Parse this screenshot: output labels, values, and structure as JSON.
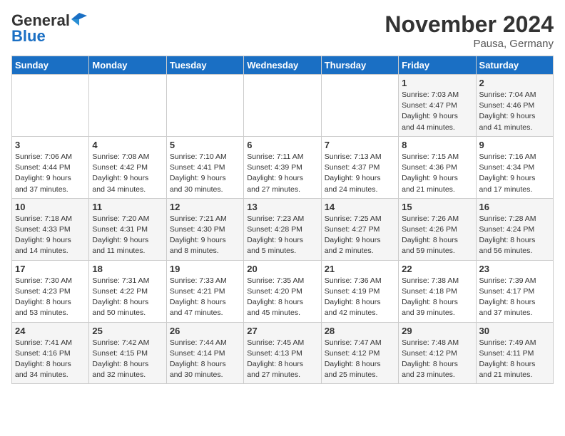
{
  "header": {
    "logo_line1": "General",
    "logo_line2": "Blue",
    "month": "November 2024",
    "location": "Pausa, Germany"
  },
  "weekdays": [
    "Sunday",
    "Monday",
    "Tuesday",
    "Wednesday",
    "Thursday",
    "Friday",
    "Saturday"
  ],
  "weeks": [
    [
      {
        "day": "",
        "info": ""
      },
      {
        "day": "",
        "info": ""
      },
      {
        "day": "",
        "info": ""
      },
      {
        "day": "",
        "info": ""
      },
      {
        "day": "",
        "info": ""
      },
      {
        "day": "1",
        "info": "Sunrise: 7:03 AM\nSunset: 4:47 PM\nDaylight: 9 hours\nand 44 minutes."
      },
      {
        "day": "2",
        "info": "Sunrise: 7:04 AM\nSunset: 4:46 PM\nDaylight: 9 hours\nand 41 minutes."
      }
    ],
    [
      {
        "day": "3",
        "info": "Sunrise: 7:06 AM\nSunset: 4:44 PM\nDaylight: 9 hours\nand 37 minutes."
      },
      {
        "day": "4",
        "info": "Sunrise: 7:08 AM\nSunset: 4:42 PM\nDaylight: 9 hours\nand 34 minutes."
      },
      {
        "day": "5",
        "info": "Sunrise: 7:10 AM\nSunset: 4:41 PM\nDaylight: 9 hours\nand 30 minutes."
      },
      {
        "day": "6",
        "info": "Sunrise: 7:11 AM\nSunset: 4:39 PM\nDaylight: 9 hours\nand 27 minutes."
      },
      {
        "day": "7",
        "info": "Sunrise: 7:13 AM\nSunset: 4:37 PM\nDaylight: 9 hours\nand 24 minutes."
      },
      {
        "day": "8",
        "info": "Sunrise: 7:15 AM\nSunset: 4:36 PM\nDaylight: 9 hours\nand 21 minutes."
      },
      {
        "day": "9",
        "info": "Sunrise: 7:16 AM\nSunset: 4:34 PM\nDaylight: 9 hours\nand 17 minutes."
      }
    ],
    [
      {
        "day": "10",
        "info": "Sunrise: 7:18 AM\nSunset: 4:33 PM\nDaylight: 9 hours\nand 14 minutes."
      },
      {
        "day": "11",
        "info": "Sunrise: 7:20 AM\nSunset: 4:31 PM\nDaylight: 9 hours\nand 11 minutes."
      },
      {
        "day": "12",
        "info": "Sunrise: 7:21 AM\nSunset: 4:30 PM\nDaylight: 9 hours\nand 8 minutes."
      },
      {
        "day": "13",
        "info": "Sunrise: 7:23 AM\nSunset: 4:28 PM\nDaylight: 9 hours\nand 5 minutes."
      },
      {
        "day": "14",
        "info": "Sunrise: 7:25 AM\nSunset: 4:27 PM\nDaylight: 9 hours\nand 2 minutes."
      },
      {
        "day": "15",
        "info": "Sunrise: 7:26 AM\nSunset: 4:26 PM\nDaylight: 8 hours\nand 59 minutes."
      },
      {
        "day": "16",
        "info": "Sunrise: 7:28 AM\nSunset: 4:24 PM\nDaylight: 8 hours\nand 56 minutes."
      }
    ],
    [
      {
        "day": "17",
        "info": "Sunrise: 7:30 AM\nSunset: 4:23 PM\nDaylight: 8 hours\nand 53 minutes."
      },
      {
        "day": "18",
        "info": "Sunrise: 7:31 AM\nSunset: 4:22 PM\nDaylight: 8 hours\nand 50 minutes."
      },
      {
        "day": "19",
        "info": "Sunrise: 7:33 AM\nSunset: 4:21 PM\nDaylight: 8 hours\nand 47 minutes."
      },
      {
        "day": "20",
        "info": "Sunrise: 7:35 AM\nSunset: 4:20 PM\nDaylight: 8 hours\nand 45 minutes."
      },
      {
        "day": "21",
        "info": "Sunrise: 7:36 AM\nSunset: 4:19 PM\nDaylight: 8 hours\nand 42 minutes."
      },
      {
        "day": "22",
        "info": "Sunrise: 7:38 AM\nSunset: 4:18 PM\nDaylight: 8 hours\nand 39 minutes."
      },
      {
        "day": "23",
        "info": "Sunrise: 7:39 AM\nSunset: 4:17 PM\nDaylight: 8 hours\nand 37 minutes."
      }
    ],
    [
      {
        "day": "24",
        "info": "Sunrise: 7:41 AM\nSunset: 4:16 PM\nDaylight: 8 hours\nand 34 minutes."
      },
      {
        "day": "25",
        "info": "Sunrise: 7:42 AM\nSunset: 4:15 PM\nDaylight: 8 hours\nand 32 minutes."
      },
      {
        "day": "26",
        "info": "Sunrise: 7:44 AM\nSunset: 4:14 PM\nDaylight: 8 hours\nand 30 minutes."
      },
      {
        "day": "27",
        "info": "Sunrise: 7:45 AM\nSunset: 4:13 PM\nDaylight: 8 hours\nand 27 minutes."
      },
      {
        "day": "28",
        "info": "Sunrise: 7:47 AM\nSunset: 4:12 PM\nDaylight: 8 hours\nand 25 minutes."
      },
      {
        "day": "29",
        "info": "Sunrise: 7:48 AM\nSunset: 4:12 PM\nDaylight: 8 hours\nand 23 minutes."
      },
      {
        "day": "30",
        "info": "Sunrise: 7:49 AM\nSunset: 4:11 PM\nDaylight: 8 hours\nand 21 minutes."
      }
    ]
  ]
}
